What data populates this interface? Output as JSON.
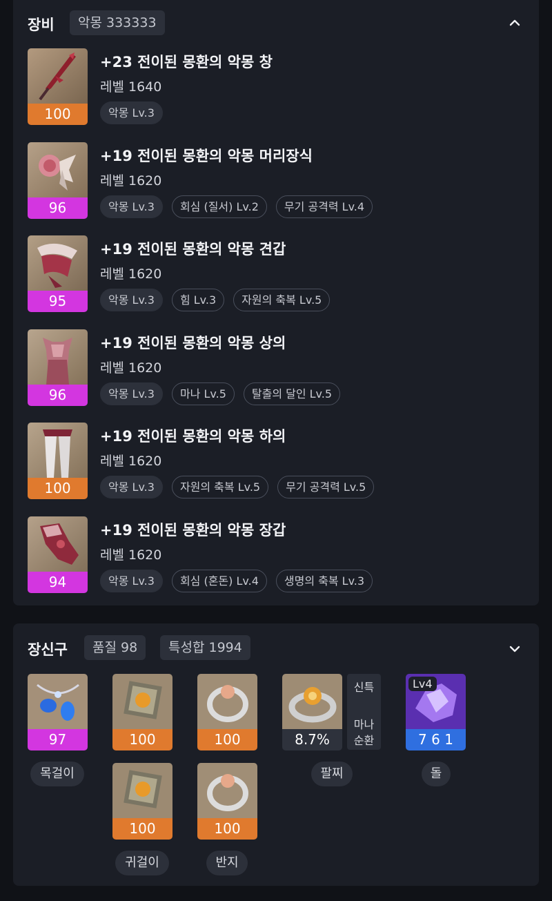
{
  "equipment": {
    "title": "장비",
    "badge": "악몽 333333",
    "items": [
      {
        "name": "+23 전이된 몽환의 악몽 창",
        "level": "레벨 1640",
        "quality": "100",
        "quality_color": "#e07a2e",
        "icon": "spear-icon",
        "tags": [
          {
            "label": "악몽 Lv.3"
          }
        ]
      },
      {
        "name": "+19 전이된 몽환의 악몽 머리장식",
        "level": "레벨 1620",
        "quality": "96",
        "quality_color": "#d336e0",
        "icon": "headgear-icon",
        "tags": [
          {
            "label": "악몽 Lv.3"
          },
          {
            "label": "회심 (질서) Lv.2"
          },
          {
            "label": "무기 공격력 Lv.4"
          }
        ]
      },
      {
        "name": "+19 전이된 몽환의 악몽 견갑",
        "level": "레벨 1620",
        "quality": "95",
        "quality_color": "#d336e0",
        "icon": "shoulder-icon",
        "tags": [
          {
            "label": "악몽 Lv.3"
          },
          {
            "label": "힘 Lv.3"
          },
          {
            "label": "자원의 축복 Lv.5"
          }
        ]
      },
      {
        "name": "+19 전이된 몽환의 악몽 상의",
        "level": "레벨 1620",
        "quality": "96",
        "quality_color": "#d336e0",
        "icon": "chest-armor-icon",
        "tags": [
          {
            "label": "악몽 Lv.3"
          },
          {
            "label": "마나 Lv.5"
          },
          {
            "label": "탈출의 달인 Lv.5"
          }
        ]
      },
      {
        "name": "+19 전이된 몽환의 악몽 하의",
        "level": "레벨 1620",
        "quality": "100",
        "quality_color": "#e07a2e",
        "icon": "leggings-icon",
        "tags": [
          {
            "label": "악몽 Lv.3"
          },
          {
            "label": "자원의 축복 Lv.5"
          },
          {
            "label": "무기 공격력 Lv.5"
          }
        ]
      },
      {
        "name": "+19 전이된 몽환의 악몽 장갑",
        "level": "레벨 1620",
        "quality": "94",
        "quality_color": "#d336e0",
        "icon": "gloves-icon",
        "tags": [
          {
            "label": "악몽 Lv.3"
          },
          {
            "label": "회심 (혼돈) Lv.4"
          },
          {
            "label": "생명의 축복 Lv.3"
          }
        ]
      }
    ]
  },
  "accessories": {
    "title": "장신구",
    "quality_badge": "품질 98",
    "stat_badge": "특성합 1994",
    "necklace": {
      "quality": "97",
      "label": "목걸이",
      "icon": "necklace-icon"
    },
    "earrings": [
      {
        "quality": "100",
        "icon": "earring-icon"
      },
      {
        "quality": "100",
        "icon": "earring-icon"
      }
    ],
    "earring_label": "귀걸이",
    "rings": [
      {
        "quality": "100",
        "icon": "ring-icon"
      },
      {
        "quality": "100",
        "icon": "ring-icon"
      }
    ],
    "ring_label": "반지",
    "bracelet": {
      "value": "8.7%",
      "effects": [
        "신특",
        "마나",
        "순환"
      ],
      "label": "팔찌",
      "icon": "bracelet-icon"
    },
    "stone": {
      "level_badge": "Lv4",
      "value": "7 6 1",
      "label": "돌",
      "icon": "ability-stone-icon"
    }
  },
  "colors": {
    "orange": "#e07a2e",
    "purple": "#d336e0",
    "blue": "#2f6fe0",
    "panel": "#1b1e26",
    "background": "#101217"
  }
}
